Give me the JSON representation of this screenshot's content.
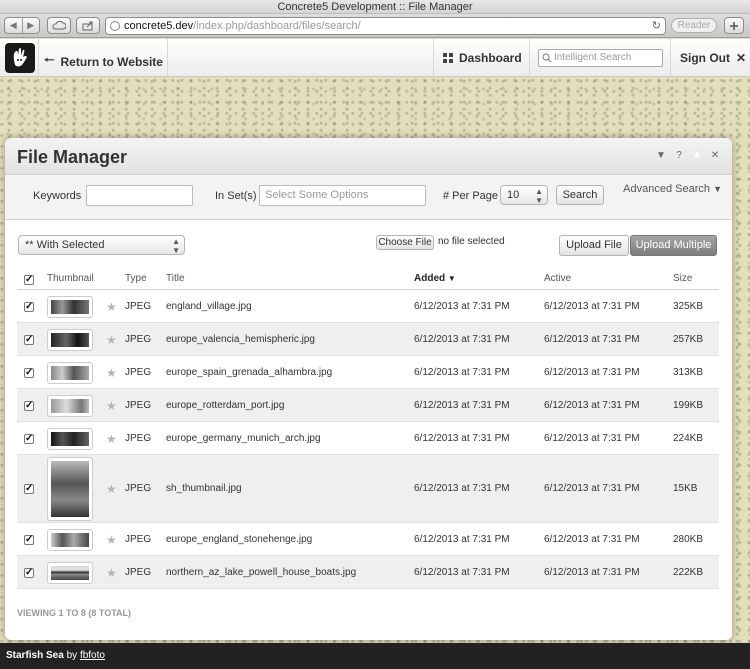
{
  "browser": {
    "title": "Concrete5 Development :: File Manager",
    "url_host": "concrete5.dev",
    "url_path": "/index.php/dashboard/files/search/",
    "reader_label": "Reader"
  },
  "cms_bar": {
    "return_label": "Return to Website",
    "dashboard_label": "Dashboard",
    "search_placeholder": "Intelligent Search",
    "sign_out_label": "Sign Out"
  },
  "dialog": {
    "title": "File Manager",
    "search": {
      "keywords_label": "Keywords",
      "keywords_value": "",
      "in_sets_label": "In Set(s)",
      "in_sets_placeholder": "Select Some Options",
      "per_page_label": "# Per Page",
      "per_page_value": "10",
      "search_button": "Search",
      "advanced_search": "Advanced Search"
    },
    "actions": {
      "with_selected": "** With Selected",
      "choose_file_button": "Choose File",
      "no_file_text": "no file selected",
      "upload_file": "Upload File",
      "upload_multiple": "Upload Multiple"
    },
    "table": {
      "headers": [
        "Thumbnail",
        "Type",
        "Title",
        "Added",
        "Active",
        "Size"
      ],
      "rows": [
        {
          "type": "JPEG",
          "title": "england_village.jpg",
          "added": "6/12/2013 at 7:31 PM",
          "active": "6/12/2013 at 7:31 PM",
          "size": "325KB",
          "checked": true
        },
        {
          "type": "JPEG",
          "title": "europe_valencia_hemispheric.jpg",
          "added": "6/12/2013 at 7:31 PM",
          "active": "6/12/2013 at 7:31 PM",
          "size": "257KB",
          "checked": true
        },
        {
          "type": "JPEG",
          "title": "europe_spain_grenada_alhambra.jpg",
          "added": "6/12/2013 at 7:31 PM",
          "active": "6/12/2013 at 7:31 PM",
          "size": "313KB",
          "checked": true
        },
        {
          "type": "JPEG",
          "title": "europe_rotterdam_port.jpg",
          "added": "6/12/2013 at 7:31 PM",
          "active": "6/12/2013 at 7:31 PM",
          "size": "199KB",
          "checked": true
        },
        {
          "type": "JPEG",
          "title": "europe_germany_munich_arch.jpg",
          "added": "6/12/2013 at 7:31 PM",
          "active": "6/12/2013 at 7:31 PM",
          "size": "224KB",
          "checked": true
        },
        {
          "type": "JPEG",
          "title": "sh_thumbnail.jpg",
          "added": "6/12/2013 at 7:31 PM",
          "active": "6/12/2013 at 7:31 PM",
          "size": "15KB",
          "checked": true
        },
        {
          "type": "JPEG",
          "title": "europe_england_stonehenge.jpg",
          "added": "6/12/2013 at 7:31 PM",
          "active": "6/12/2013 at 7:31 PM",
          "size": "280KB",
          "checked": true
        },
        {
          "type": "JPEG",
          "title": "northern_az_lake_powell_house_boats.jpg",
          "added": "6/12/2013 at 7:31 PM",
          "active": "6/12/2013 at 7:31 PM",
          "size": "222KB",
          "checked": true
        }
      ]
    },
    "footer_count": "VIEWING 1 TO 8 (8 TOTAL)"
  },
  "credit": {
    "title": "Starfish Sea",
    "by": "by",
    "author": "fbfoto"
  },
  "icons": {
    "sort_indicator": "sort-desc-icon",
    "star": "star-icon",
    "checkbox": "checkbox-checked-icon"
  }
}
